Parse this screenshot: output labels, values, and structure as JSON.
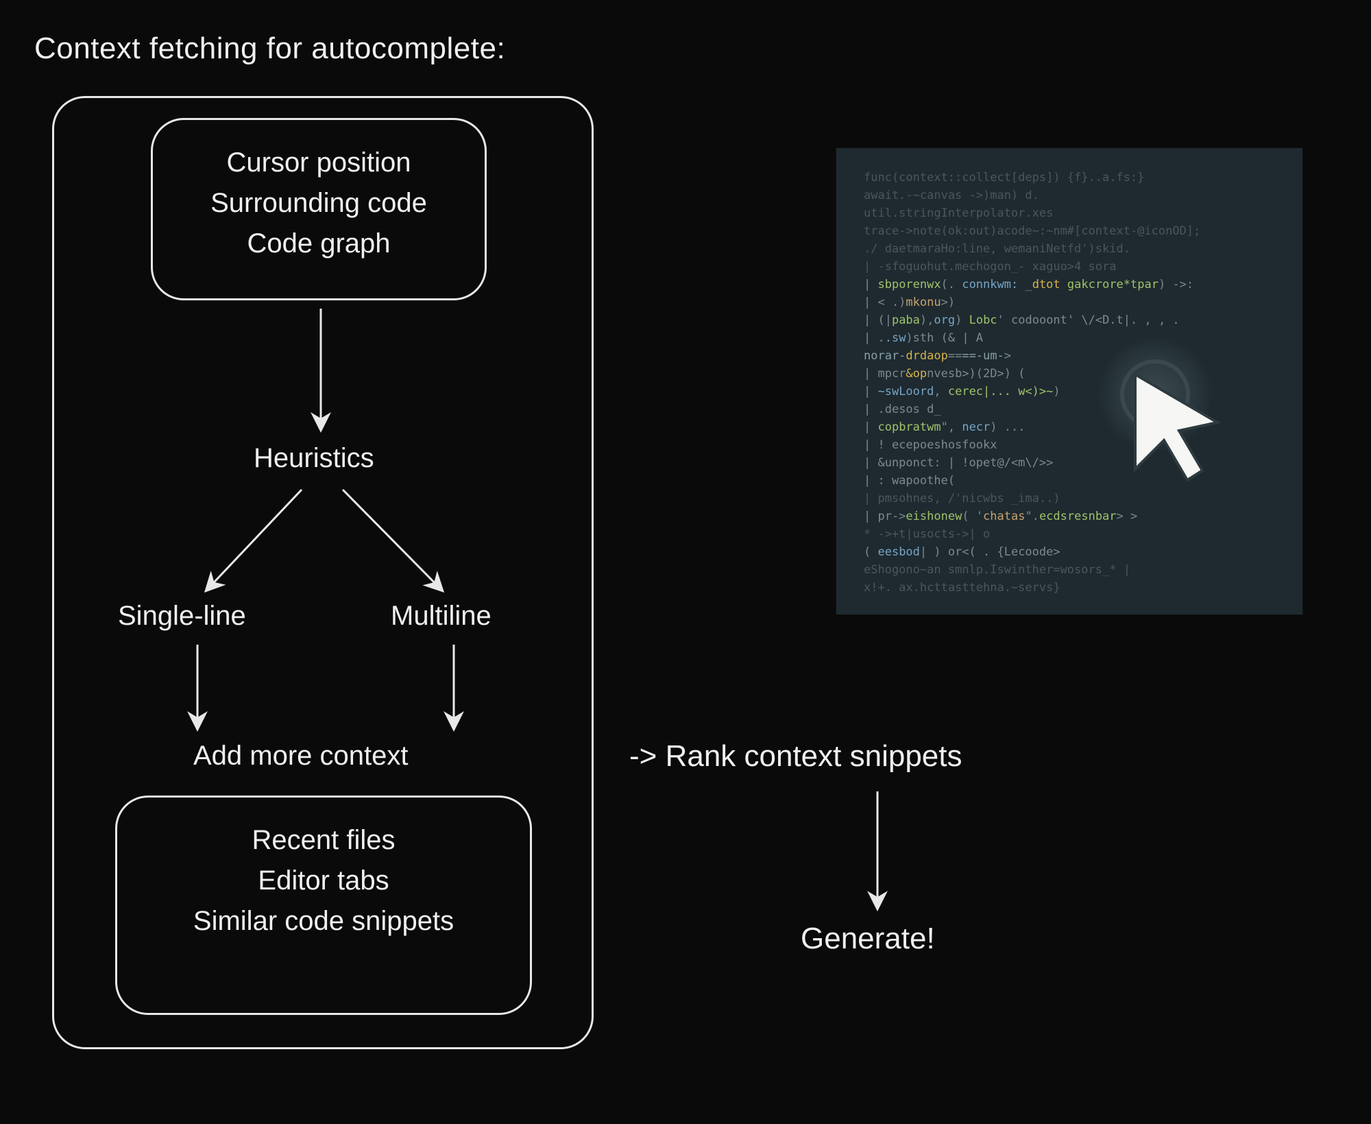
{
  "title": "Context fetching for autocomplete:",
  "inputs_box": {
    "line1": "Cursor position",
    "line2": "Surrounding code",
    "line3": "Code graph"
  },
  "heuristics_label": "Heuristics",
  "branch_left": "Single-line",
  "branch_right": "Multiline",
  "add_more_label": "Add more context",
  "context_box": {
    "line1": "Recent files",
    "line2": "Editor tabs",
    "line3": "Similar code snippets"
  },
  "rank_label": "-> Rank context snippets",
  "generate_label": "Generate!",
  "code_lines": [
    {
      "cls": "tok-dim",
      "text": "func(context::collect[deps]) {f}..a.fs:}"
    },
    {
      "cls": "tok-dim",
      "text": "await.-~canvas  ->)man)  d."
    },
    {
      "cls": "tok-dim",
      "text": "util.stringInterpolator.xes"
    },
    {
      "cls": "tok-dim",
      "text": "trace->note(ok:out)acode~:~nm#[context-@iconOD];"
    },
    {
      "cls": "tok-dim",
      "text": "./ daetmaraHo:line, wemaniNetfd')skid."
    },
    {
      "cls": "tok-dim",
      "text": " |  -sfoguohut.mechogon_-       xaguo>4  sora"
    },
    {
      "cls": "",
      "text": " |   <span class='tok-fn'>sbporenwx</span>(. <span class='tok-kw'>connkwm:</span> _<span class='tok-cur'>dtot</span> <span class='tok-fn'>gakcrore*tpar</span>)  -&gt;:"
    },
    {
      "cls": "",
      "text": " |  &lt; .)<span class='tok-str'>mkonu</span>&gt;)"
    },
    {
      "cls": "",
      "text": " |  (|<span class='tok-fn'>paba</span>),<span class='tok-kw'>org</span>) <span class='tok-fn'>Lobc</span>' codooont' \\/&lt;D.t|. , , ."
    },
    {
      "cls": "",
      "text": " |  .<span class='tok-kw'>.sw</span>)sth (&amp; |  A"
    },
    {
      "cls": "",
      "text": "<span class='tok-op'>norar-</span><span class='tok-cur'>drdaop</span>==<span class='tok-op'>==-um-</span>&gt;"
    },
    {
      "cls": "",
      "text": "| mpcr<span class='tok-cur'>&amp;op</span>nvesb&gt;)(2D&gt;) ("
    },
    {
      "cls": "",
      "text": "| <span class='tok-kw'>~swLoord</span>, <span class='tok-fn'>cerec|... w&lt;)&gt;~</span>)"
    },
    {
      "cls": "",
      "text": "| .desos  d_"
    },
    {
      "cls": "",
      "text": "|   <span class='tok-fn'>copbratwm</span>&#34;, <span class='tok-kw'>necr</span>)  ..."
    },
    {
      "cls": "",
      "text": "| !  ecepoeshosfookx"
    },
    {
      "cls": "",
      "text": "| &amp;unponct: | !opet@/&lt;m\\/&gt;&gt;"
    },
    {
      "cls": "",
      "text": "| :   wapoothe("
    },
    {
      "cls": "tok-dim",
      "text": "|     pmsohnes, /'nicwbs _ima..)"
    },
    {
      "cls": "",
      "text": "|  pr-&gt;<span class='tok-fn'>eishonew</span>( '<span class='tok-str'>chatas</span>&quot;.<span class='tok-fn'>ecdsresnbar</span>&gt; &gt;"
    },
    {
      "cls": "tok-dim",
      "text": "* -&gt;+t|usocts-&gt;| o"
    },
    {
      "cls": "",
      "text": "( <span class='tok-kw'>eesbod</span>| )  or&lt;(  .  {Lecoode&gt;"
    },
    {
      "cls": "tok-dim",
      "text": "eShogono~an  smnlp.Iswinther=wosors_*  |"
    },
    {
      "cls": "tok-dim",
      "text": "x!+. ax.hcttasttehna.~servs}"
    }
  ]
}
